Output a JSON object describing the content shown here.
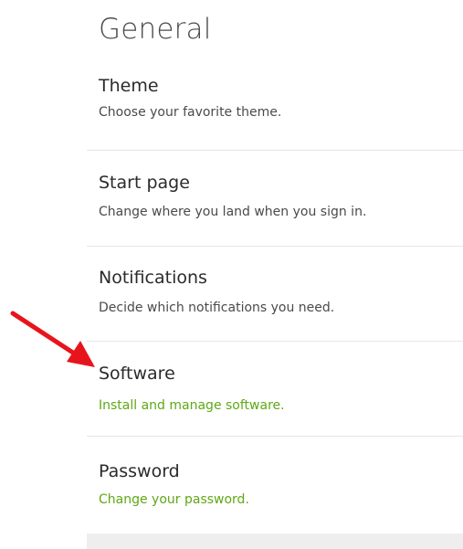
{
  "page": {
    "title": "General"
  },
  "settings": {
    "items": [
      {
        "title": "Theme",
        "description": "Choose your favorite theme."
      },
      {
        "title": "Start page",
        "description": "Change where you land when you sign in."
      },
      {
        "title": "Notifications",
        "description": "Decide which notifications you need."
      },
      {
        "title": "Software",
        "description": "Install and manage software."
      },
      {
        "title": "Password",
        "description": "Change your password."
      }
    ]
  },
  "colors": {
    "link_green": "#5fa815",
    "annotation_arrow": "#e8141c"
  },
  "annotation": {
    "icon": "red-arrow-pointing-to-software"
  }
}
